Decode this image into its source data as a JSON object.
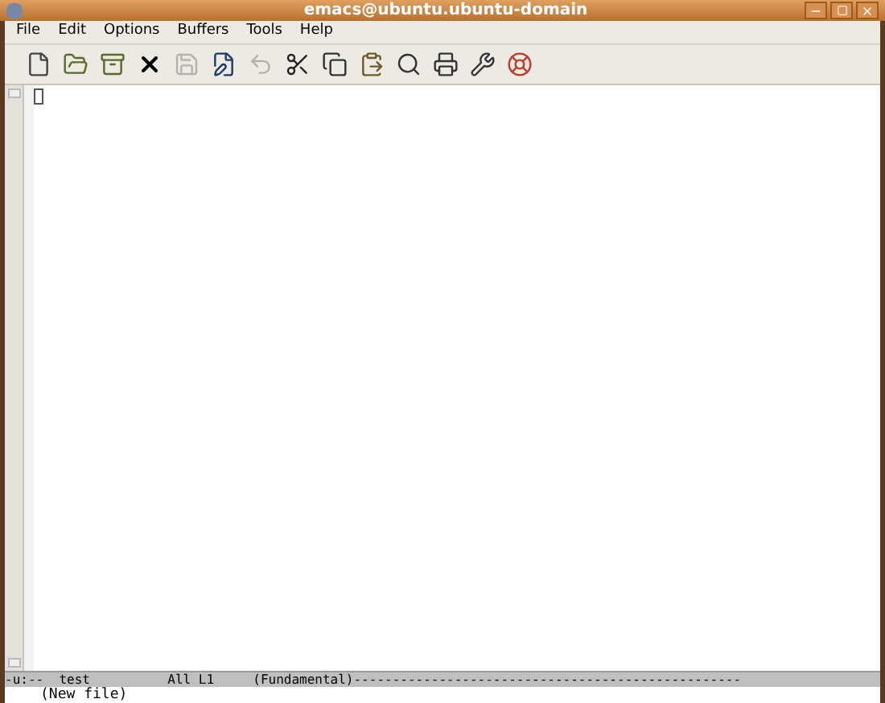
{
  "window": {
    "title": "emacs@ubuntu.ubuntu-domain"
  },
  "menu": [
    "File",
    "Edit",
    "Options",
    "Buffers",
    "Tools",
    "Help"
  ],
  "toolbar": [
    {
      "kind": "new",
      "disabled": false
    },
    {
      "kind": "open",
      "disabled": false
    },
    {
      "kind": "cabinet",
      "disabled": false
    },
    {
      "kind": "close",
      "disabled": false
    },
    {
      "kind": "save",
      "disabled": true
    },
    {
      "kind": "saveas",
      "disabled": false
    },
    {
      "kind": "undo",
      "disabled": true
    },
    {
      "kind": "cut",
      "disabled": false
    },
    {
      "kind": "copy",
      "disabled": false
    },
    {
      "kind": "paste",
      "disabled": false
    },
    {
      "kind": "search",
      "disabled": false
    },
    {
      "kind": "print",
      "disabled": false
    },
    {
      "kind": "tools",
      "disabled": false
    },
    {
      "kind": "help",
      "disabled": false
    }
  ],
  "mode_line": {
    "text": "-u:--  test          All L1     (Fundamental)--------------------------------------------------"
  },
  "minibuffer": {
    "text": "(New file)"
  }
}
